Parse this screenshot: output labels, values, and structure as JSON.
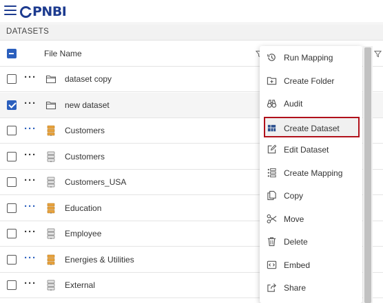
{
  "app": {
    "logo_text": "PNBI"
  },
  "section": {
    "title": "DATASETS"
  },
  "table": {
    "column_header": "File Name",
    "rows": [
      {
        "label": "dataset copy",
        "icon": "folder-icon",
        "checked": false,
        "dots_color": "dark"
      },
      {
        "label": "new dataset",
        "icon": "folder-icon",
        "checked": true,
        "dots_color": "dark"
      },
      {
        "label": "Customers",
        "icon": "dataset-orange-icon",
        "checked": false,
        "dots_color": "blue"
      },
      {
        "label": "Customers",
        "icon": "dataset-gray-icon",
        "checked": false,
        "dots_color": "dark"
      },
      {
        "label": "Customers_USA",
        "icon": "dataset-gray-icon",
        "checked": false,
        "dots_color": "dark"
      },
      {
        "label": "Education",
        "icon": "dataset-orange-icon",
        "checked": false,
        "dots_color": "blue"
      },
      {
        "label": "Employee",
        "icon": "dataset-gray-icon",
        "checked": false,
        "dots_color": "dark"
      },
      {
        "label": "Energies & Utilities",
        "icon": "dataset-orange-icon",
        "checked": false,
        "dots_color": "blue"
      },
      {
        "label": "External",
        "icon": "dataset-gray-icon",
        "checked": false,
        "dots_color": "dark"
      }
    ]
  },
  "context_menu": {
    "items": [
      {
        "label": "Run Mapping",
        "icon": "history-icon"
      },
      {
        "label": "Create Folder",
        "icon": "folder-plus-icon"
      },
      {
        "label": "Audit",
        "icon": "binoculars-icon"
      },
      {
        "label": "Create Dataset",
        "icon": "table-icon",
        "highlighted": true
      },
      {
        "label": "Edit Dataset",
        "icon": "edit-icon"
      },
      {
        "label": "Create Mapping",
        "icon": "mapping-icon"
      },
      {
        "label": "Copy",
        "icon": "copy-icon"
      },
      {
        "label": "Move",
        "icon": "scissors-icon"
      },
      {
        "label": "Delete",
        "icon": "trash-icon"
      },
      {
        "label": "Embed",
        "icon": "embed-icon"
      },
      {
        "label": "Share",
        "icon": "share-icon"
      }
    ]
  },
  "colors": {
    "brand": "#1d3b8f",
    "accent": "#2b5fbd",
    "highlight_border": "#b0101a",
    "orange_icon": "#e8a33d"
  }
}
